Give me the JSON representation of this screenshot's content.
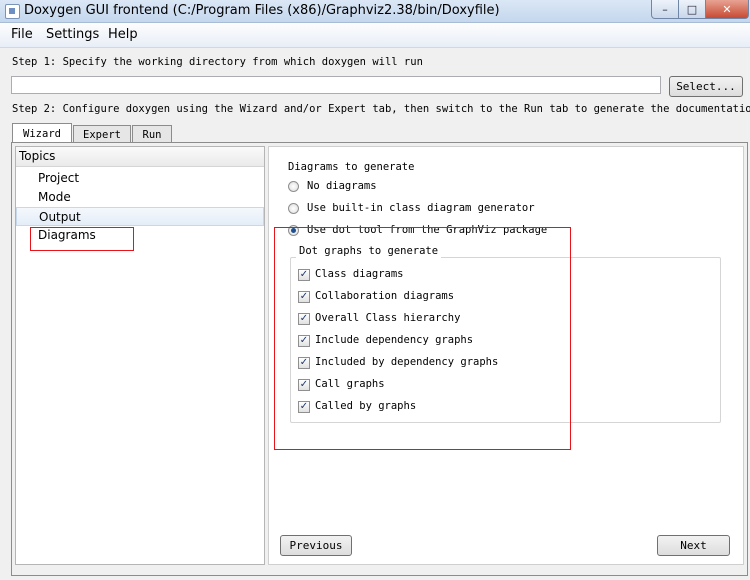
{
  "window": {
    "title": "Doxygen GUI frontend (C:/Program Files (x86)/Graphviz2.38/bin/Doxyfile)",
    "minimize": "–",
    "maximize": "□",
    "close": "✕"
  },
  "menu": {
    "file": "File",
    "settings": "Settings",
    "help": "Help"
  },
  "step1": {
    "label": "Step 1: Specify the working directory from which doxygen will run",
    "input_value": "",
    "select_button": "Select..."
  },
  "step2": {
    "label": "Step 2: Configure doxygen using the Wizard and/or Expert tab, then switch to the Run tab to generate the documentation"
  },
  "tabs": [
    "Wizard",
    "Expert",
    "Run"
  ],
  "topics": {
    "header": "Topics",
    "items": [
      "Project",
      "Mode",
      "Output",
      "Diagrams"
    ],
    "selected": "Output"
  },
  "diagrams": {
    "heading": "Diagrams to generate",
    "options": [
      {
        "label": "No diagrams",
        "selected": false
      },
      {
        "label": "Use built-in class diagram generator",
        "selected": false
      },
      {
        "label": "Use dot tool from the GraphViz package",
        "selected": true
      }
    ],
    "dot_group_title": "Dot graphs to generate",
    "dot_graphs": [
      {
        "label": "Class diagrams",
        "checked": true
      },
      {
        "label": "Collaboration diagrams",
        "checked": true
      },
      {
        "label": "Overall Class hierarchy",
        "checked": true
      },
      {
        "label": "Include dependency graphs",
        "checked": true
      },
      {
        "label": "Included by dependency graphs",
        "checked": true
      },
      {
        "label": "Call graphs",
        "checked": true
      },
      {
        "label": "Called by graphs",
        "checked": true
      }
    ]
  },
  "nav": {
    "previous": "Previous",
    "next": "Next"
  },
  "colors": {
    "highlight_box": "#e8141a",
    "title_bar": "#c4d7ee"
  }
}
